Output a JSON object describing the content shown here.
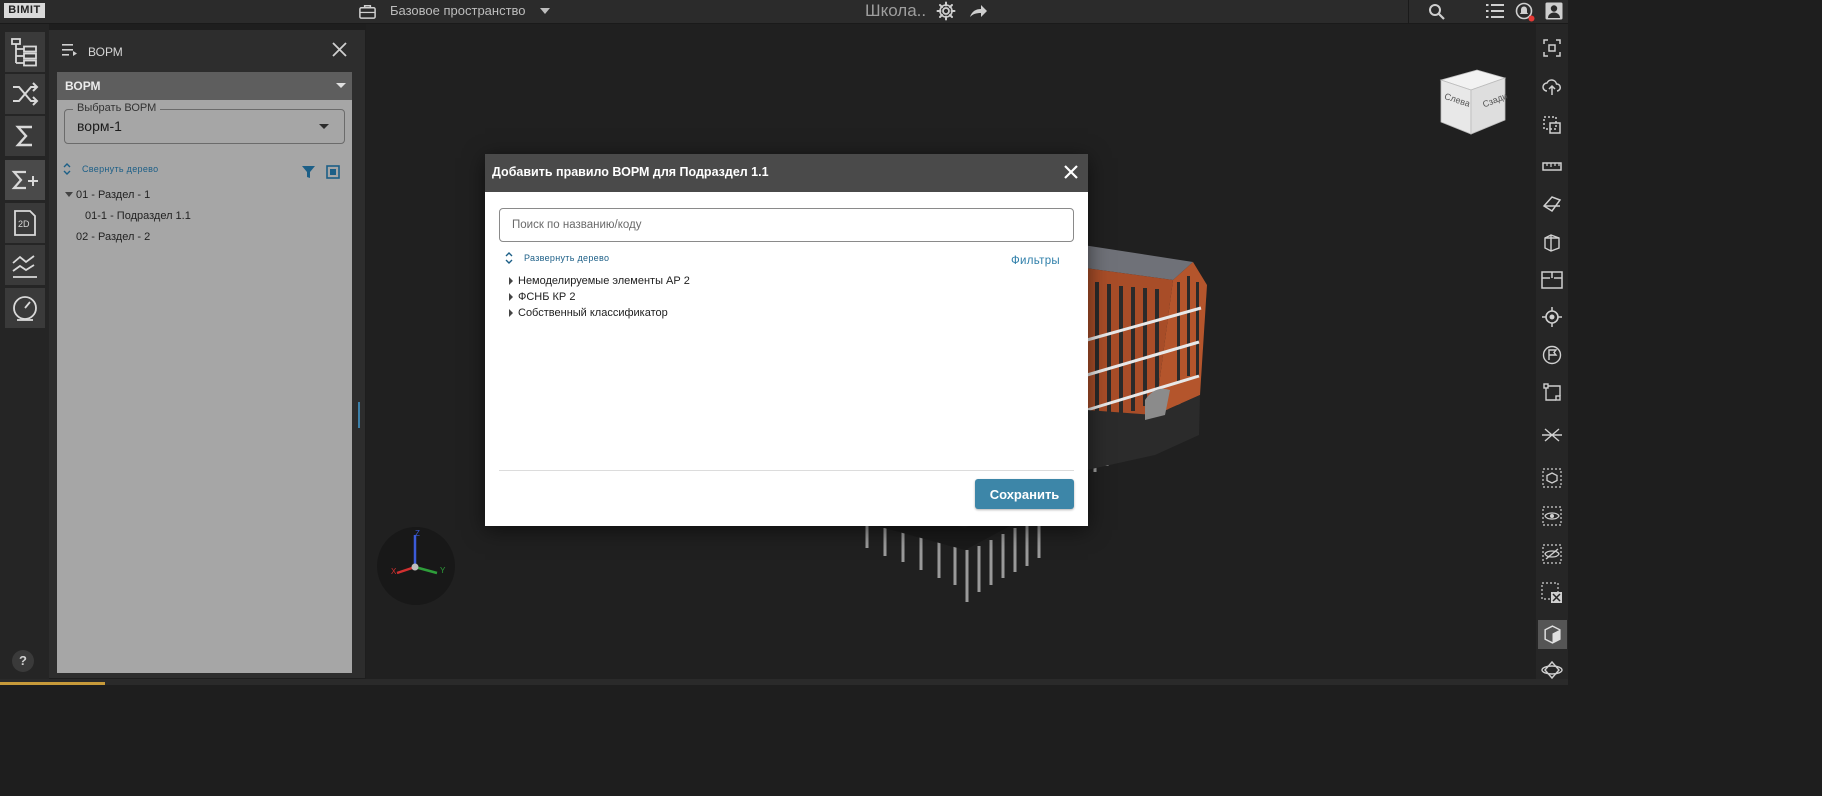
{
  "app": {
    "logo": "BIMIT"
  },
  "topbar": {
    "space_label": "Базовое пространство",
    "project_name": "Школа.."
  },
  "panel": {
    "title": "ВОРМ",
    "section_header": "ВОРМ",
    "select_label": "Выбрать ВОРМ",
    "select_value": "ворм-1",
    "collapse_tree_label": "Свернуть дерево",
    "tree": [
      {
        "label": "01 - Раздел - 1",
        "expanded": true
      },
      {
        "label": "01-1 - Подраздел 1.1"
      },
      {
        "label": "02 - Раздел - 2"
      }
    ]
  },
  "viewcube": {
    "face_left": "Слева",
    "face_right": "Сзади"
  },
  "gizmo": {
    "x": "X",
    "y": "Y",
    "z": "Z"
  },
  "modal": {
    "title": "Добавить правило ВОРМ для Подраздел 1.1",
    "search_placeholder": "Поиск по названию/коду",
    "expand_tree_label": "Развернуть дерево",
    "filters_label": "Фильтры",
    "classifiers": [
      {
        "label": "Немоделируемые элементы АР 2"
      },
      {
        "label": "ФСНБ КР 2"
      },
      {
        "label": "Собственный классификатор"
      }
    ],
    "save_label": "Сохранить"
  },
  "help": {
    "label": "?"
  },
  "colors": {
    "accent": "#3d86a8",
    "link": "#2f7faa",
    "brick": "#b4552c"
  }
}
